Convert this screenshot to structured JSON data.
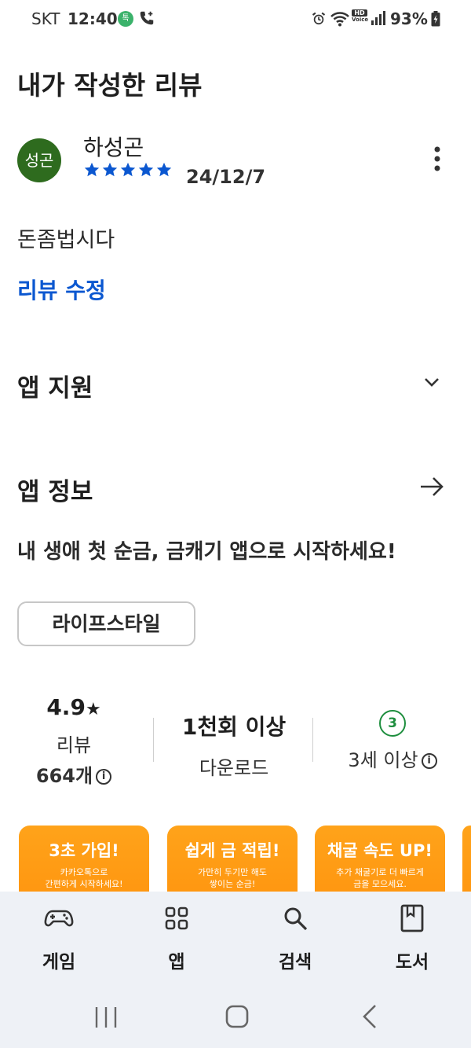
{
  "status_bar": {
    "carrier": "SKT",
    "time": "12:40",
    "battery": "93%",
    "app_badge": "톡",
    "hd_top": "HD",
    "hd_bottom": "Voice"
  },
  "page": {
    "title": "내가 작성한 리뷰"
  },
  "review": {
    "avatar_text": "성곤",
    "avatar_color": "#2e6b1e",
    "reviewer_name": "하성곤",
    "rating_stars": 5,
    "date": "24/12/7",
    "text": "돈좀법시다",
    "edit_label": "리뷰 수정"
  },
  "sections": {
    "support_title": "앱 지원",
    "info_title": "앱 정보",
    "app_description": "내 생애 첫 순금, 금캐기 앱으로 시작하세요!",
    "category": "라이프스타일"
  },
  "stats": {
    "rating": "4.9",
    "rating_star": "★",
    "rating_label": "리뷰",
    "review_count": "664개",
    "info_glyph": "i",
    "downloads": "1천회 이상",
    "downloads_label": "다운로드",
    "age_badge": "3",
    "age_label": "3세 이상"
  },
  "screenshots": [
    {
      "title": "3초 가입!",
      "line1": "카카오톡으로",
      "line2": "간편하게 시작하세요!"
    },
    {
      "title": "쉽게 금 적립!",
      "line1": "가만히 두기만 해도",
      "line2": "쌓이는 순금!"
    },
    {
      "title": "채굴 속도 UP!",
      "line1": "추가 채굴기로 더 빠르게",
      "line2": "금을 모으세요."
    }
  ],
  "bottom_nav": {
    "games": "게임",
    "apps": "앱",
    "search": "검색",
    "books": "도서"
  },
  "colors": {
    "accent_blue": "#0b57d0",
    "star_blue": "#0b57d0",
    "age_green": "#1e8e3e",
    "screenshot_orange": "#ff9a14",
    "nav_bg": "#eef1f6"
  }
}
